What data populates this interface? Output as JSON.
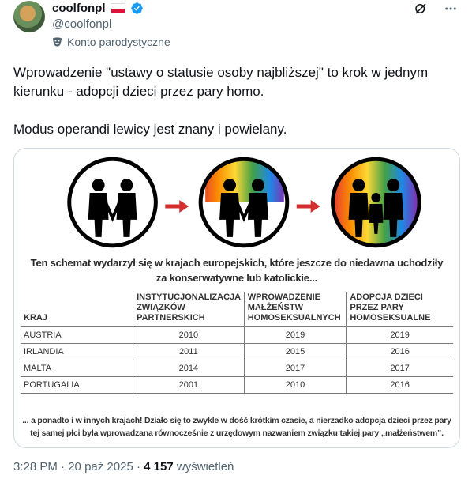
{
  "author": {
    "display_name": "coolfonpl",
    "handle": "@coolfonpl",
    "label": "Konto parodystyczne"
  },
  "tweet": {
    "paragraph1": "Wprowadzenie \"ustawy o statusie osoby najbliższej\" to krok w jednym kierunku - adopcji dzieci przez pary homo.",
    "paragraph2": "Modus operandi lewicy jest znany i powielany."
  },
  "image": {
    "headline_line1": "Ten schemat wydarzył się w krajach europejskich, które jeszcze do niedawna uchodziły",
    "headline_line2": "za konserwatywne lub katolickie...",
    "table": {
      "headers": [
        "KRAJ",
        "INSTYTUCJONALIZACJA ZWIĄZKÓW PARTNERSKICH",
        "WPROWADZENIE MAŁŻEŃSTW HOMOSEKSUALNYCH",
        "ADOPCJA DZIECI PRZEZ PARY HOMOSEKSUALNE"
      ],
      "rows": [
        [
          "AUSTRIA",
          "2010",
          "2019",
          "2019"
        ],
        [
          "IRLANDIA",
          "2011",
          "2015",
          "2016"
        ],
        [
          "MALTA",
          "2014",
          "2017",
          "2017"
        ],
        [
          "PORTUGALIA",
          "2001",
          "2010",
          "2016"
        ]
      ]
    },
    "footnote_line1": "... a ponadto i w innych krajach! Działo się to zwykle w dość krótkim czasie, a nierzadko adopcja dzieci przez pary",
    "footnote_line2": "tej samej płci była wprowadzana równocześnie z urzędowym nazwaniem związku takiej pary „małżeństwem”."
  },
  "meta": {
    "time": "3:28 PM",
    "separator1": " · ",
    "date": "20 paź 2025",
    "separator2": " · ",
    "views_count": "4 157",
    "views_label": " wyświetleń"
  },
  "colors": {
    "text_primary": "#0f1419",
    "text_secondary": "#536471",
    "verified_blue": "#1d9bf0",
    "arrow_red": "#d32f2f",
    "flag_red": "#dc143c"
  },
  "icons": [
    "verified-badge-icon",
    "grok-icon",
    "more-icon",
    "parody-mask-icon",
    "arrow-right-icon"
  ]
}
